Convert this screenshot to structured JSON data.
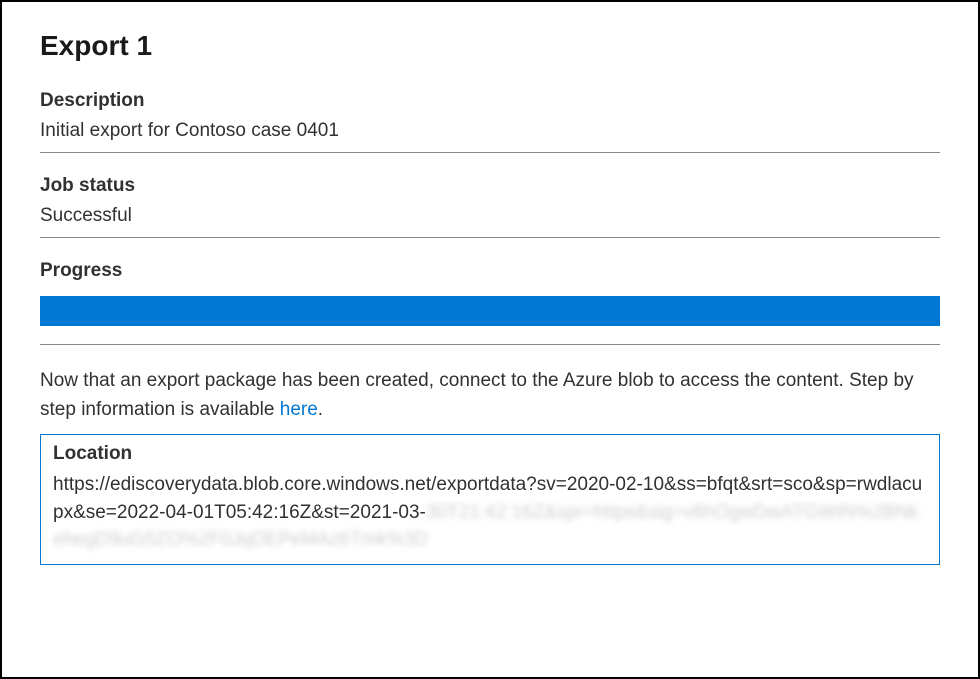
{
  "panel": {
    "title": "Export 1"
  },
  "description": {
    "label": "Description",
    "value": "Initial export for Contoso case 0401"
  },
  "job_status": {
    "label": "Job status",
    "value": "Successful"
  },
  "progress": {
    "label": "Progress",
    "percent": 100
  },
  "instructions": {
    "text_before": "Now that an export package has been created, connect to the Azure blob to access the content. Step by step information is available ",
    "link_text": "here",
    "text_after": "."
  },
  "location": {
    "label": "Location",
    "url_visible": "https://ediscoverydata.blob.core.windows.net/exportdata?sv=2020-02-10&ss=bfqt&srt=sco&sp=rwdlacupx&se=2022-04-01T05:42:16Z&st=2021-03-",
    "url_redacted": "30T21:42:16Z&spr=https&sig=v6hOgwDwATGWIN%2BNkehegD9uG5ZO%2F0JqDEPeMAz6Tmk%3D"
  },
  "colors": {
    "accent": "#0078d4",
    "text": "#323130",
    "divider": "#8a8886"
  }
}
